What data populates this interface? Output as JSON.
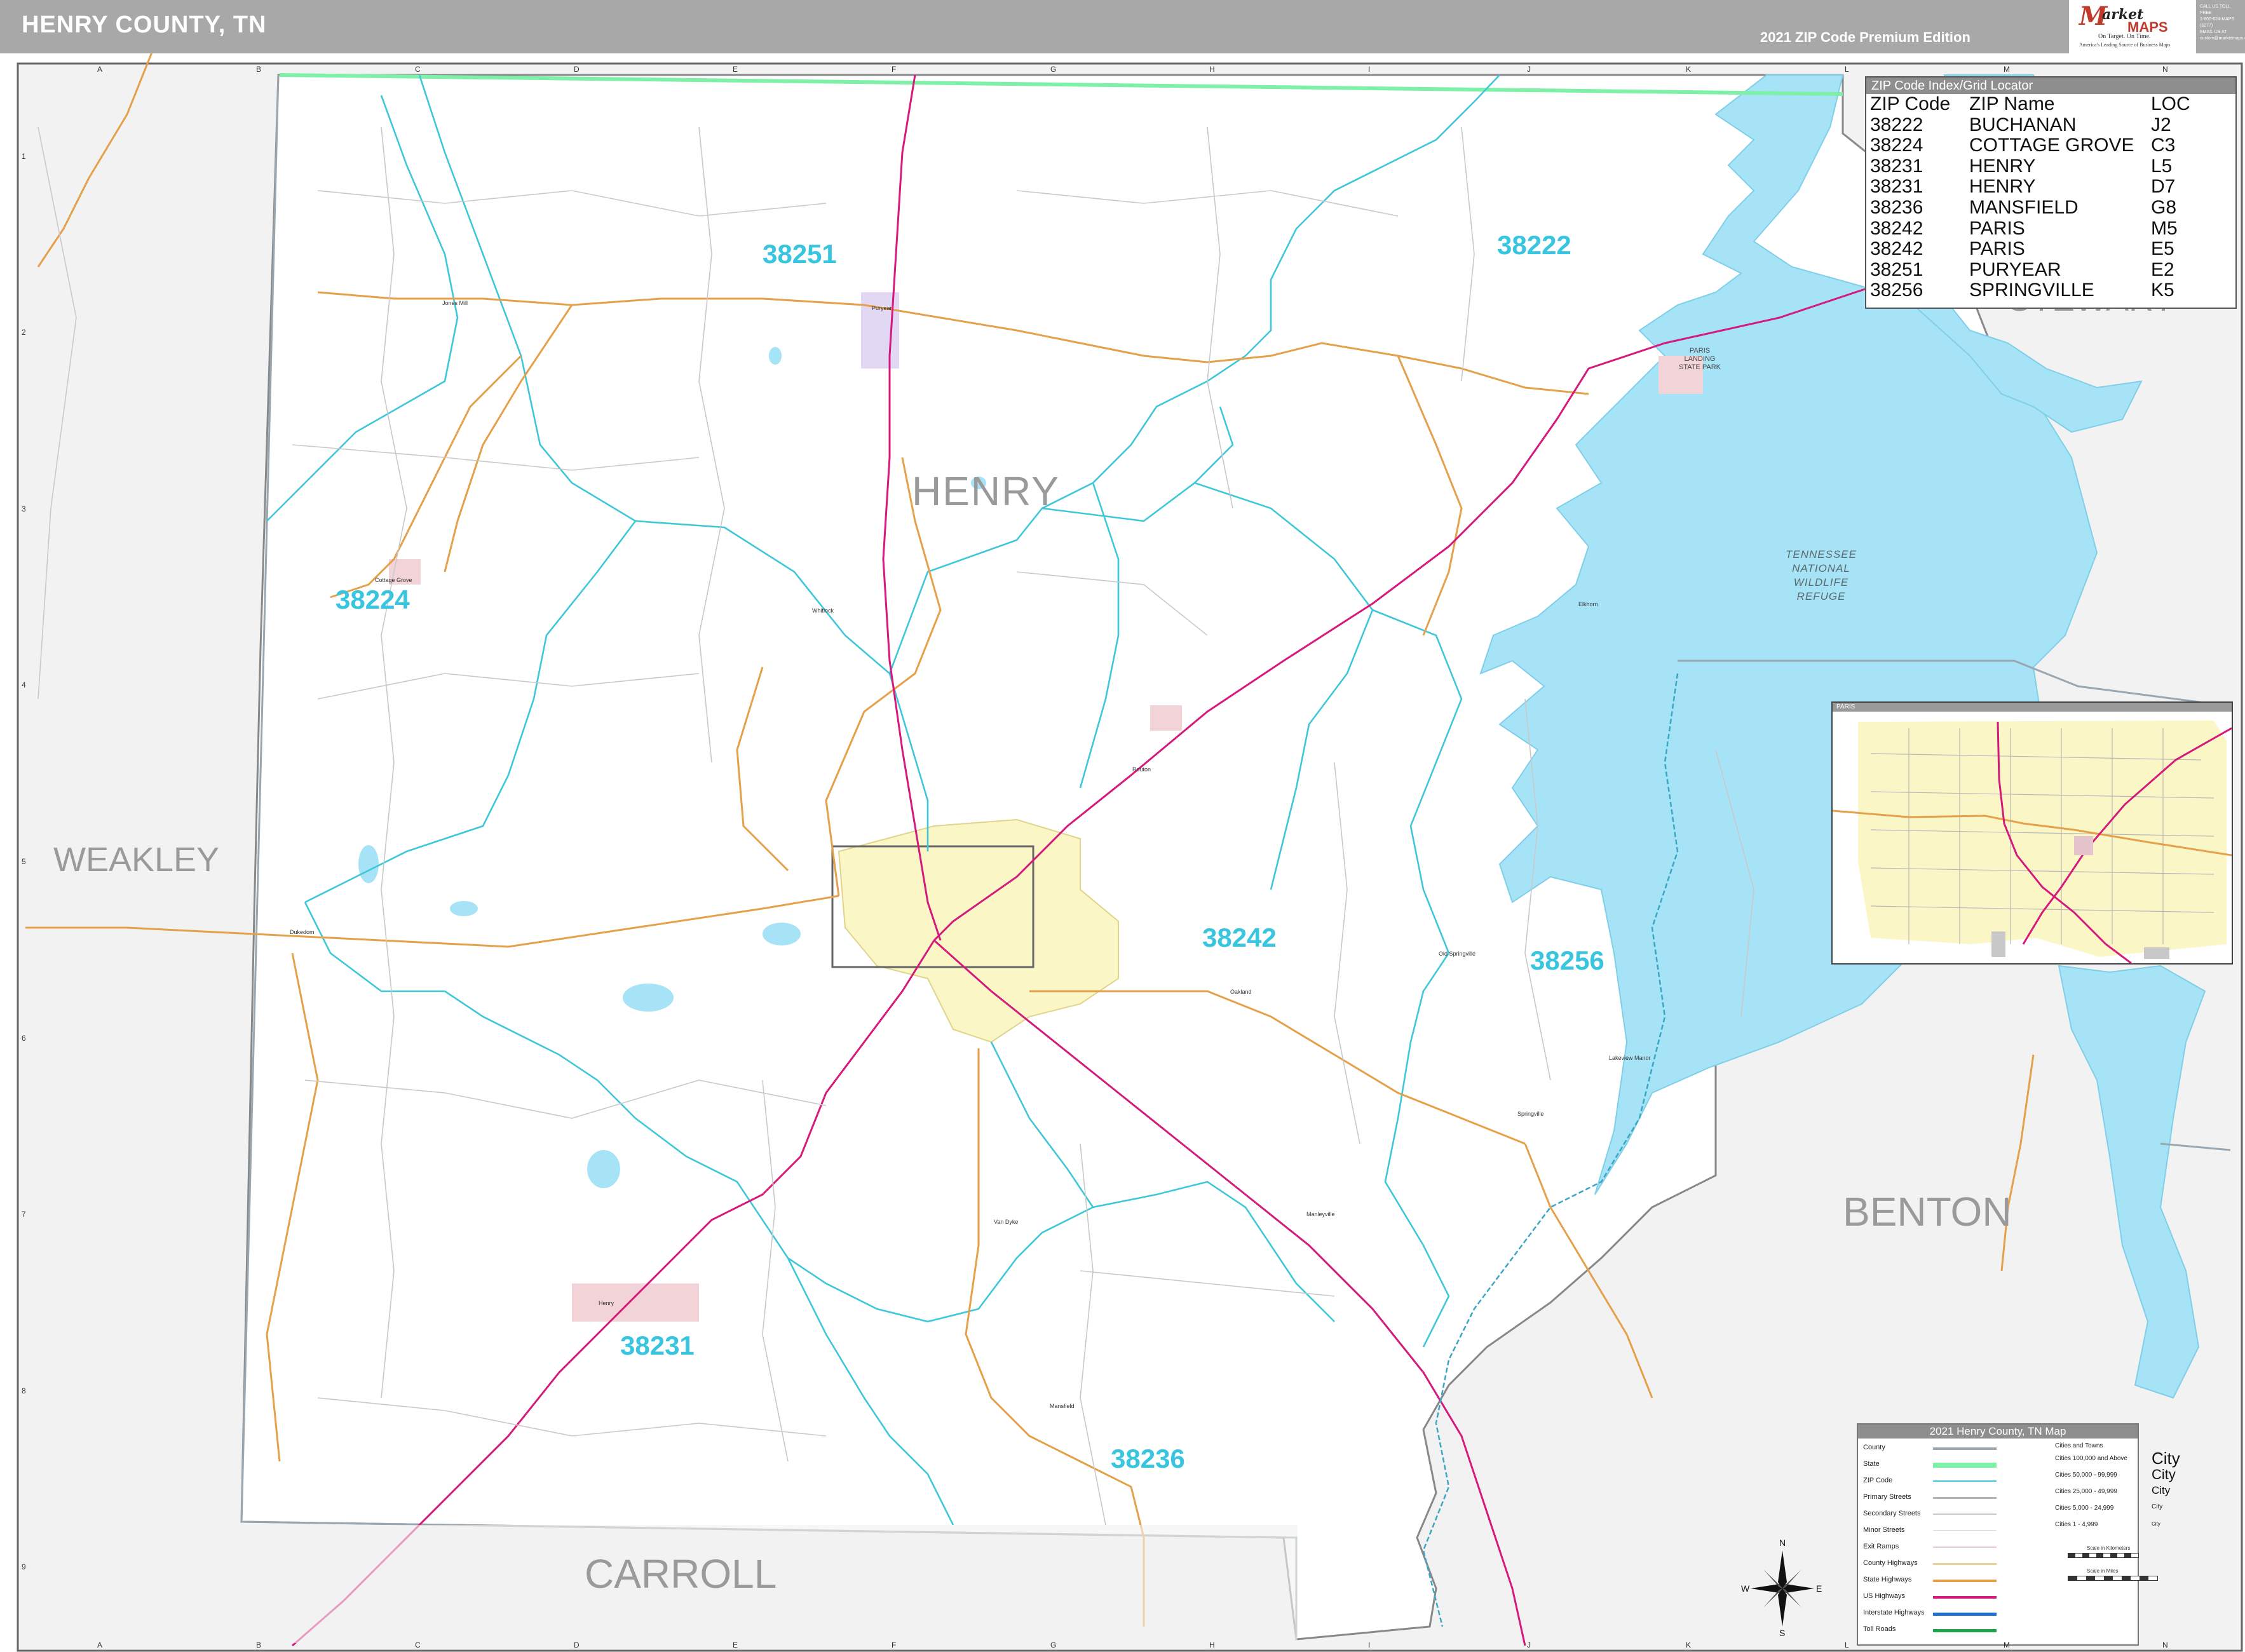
{
  "header": {
    "title": "HENRY COUNTY, TN",
    "edition": "2021 ZIP Code Premium Edition",
    "logo": {
      "brand_m": "M",
      "brand_arket": "arket",
      "brand_maps": "MAPS",
      "tagline": "On Target. On Time.",
      "subtagline": "America's Leading Source of Business Maps"
    },
    "contact": [
      "CALL US TOLL FREE",
      "1-800-624-MAPS (6277)",
      "EMAIL US AT",
      "custom@marketmaps.com"
    ]
  },
  "grid": {
    "cols": [
      "A",
      "B",
      "C",
      "D",
      "E",
      "F",
      "G",
      "H",
      "I",
      "J",
      "K",
      "L",
      "M",
      "N"
    ],
    "rows": [
      "1",
      "2",
      "3",
      "4",
      "5",
      "6",
      "7",
      "8",
      "9"
    ]
  },
  "counties": {
    "henry": "HENRY",
    "weakley": "WEAKLEY",
    "carroll": "CARROLL",
    "benton": "BENTON",
    "stewart": "STEWART"
  },
  "zip_labels": {
    "z38251": "38251",
    "z38222": "38222",
    "z38224": "38224",
    "z38242": "38242",
    "z38256": "38256",
    "z38231": "38231",
    "z38236": "38236"
  },
  "places": {
    "paris_landing": "PARIS LANDING STATE PARK",
    "refuge": "TENNESSEE NATIONAL WILDLIFE REFUGE",
    "puryear": "Puryear",
    "cottage_grove": "Cottage Grove",
    "jones_mill": "Jones Mill",
    "whitlock": "Whitlock",
    "henry": "Henry",
    "mansfield": "Mansfield",
    "springville": "Springville",
    "buchanan": "Buchanan",
    "oakland": "Oakland",
    "old_springville": "Old Springville",
    "lakeview_manor": "Lakeview Manor",
    "manleyville": "Manleyville",
    "van_dyke": "Van Dyke",
    "elkhorn": "Elkhorn",
    "routon": "Routon",
    "gleson": "Gleson",
    "dukedom": "Dukedom"
  },
  "zip_index": {
    "title": "ZIP Code Index/Grid Locator",
    "headers": [
      "ZIP Code",
      "ZIP Name",
      "LOC"
    ],
    "rows": [
      [
        "38222",
        "BUCHANAN",
        "J2"
      ],
      [
        "38224",
        "COTTAGE GROVE",
        "C3"
      ],
      [
        "38231",
        "HENRY",
        "L5"
      ],
      [
        "38231",
        "HENRY",
        "D7"
      ],
      [
        "38236",
        "MANSFIELD",
        "G8"
      ],
      [
        "38242",
        "PARIS",
        "M5"
      ],
      [
        "38242",
        "PARIS",
        "E5"
      ],
      [
        "38251",
        "PURYEAR",
        "E2"
      ],
      [
        "38256",
        "SPRINGVILLE",
        "K5"
      ]
    ]
  },
  "legend": {
    "title": "2021 Henry County, TN Map",
    "items": [
      "County",
      "State",
      "ZIP Code",
      "Primary Streets",
      "Secondary Streets",
      "Minor Streets",
      "Exit Ramps",
      "County Highways",
      "State Highways",
      "US Highways",
      "Interstate Highways",
      "Toll Roads"
    ],
    "cities_header": "Cities and Towns",
    "city_classes": [
      "Cities 100,000 and Above",
      "Cities 50,000 - 99,999",
      "Cities 25,000 - 49,999",
      "Cities 5,000 - 24,999",
      "Cities 1 - 4,999"
    ],
    "city_sample": "City",
    "scale_km": "Scale in Kilometers",
    "scale_mi": "Scale in Miles"
  },
  "compass": {
    "n": "N",
    "s": "S",
    "e": "E",
    "w": "W"
  },
  "inset": {
    "title": "PARIS"
  },
  "colors": {
    "water": "#a6e3f7",
    "zip_boundary": "#3ec7d9",
    "county_boundary": "#9aa7b0",
    "state_boundary": "#7ff0a8",
    "us_highway": "#d6197c",
    "state_highway": "#e5a04a",
    "city_fill": "#fbf6c6",
    "small_city": "#e6c4cc",
    "refuge": "#dcefe0",
    "outside_county": "#f2f2f2",
    "zip_label": "#37c5e0"
  }
}
